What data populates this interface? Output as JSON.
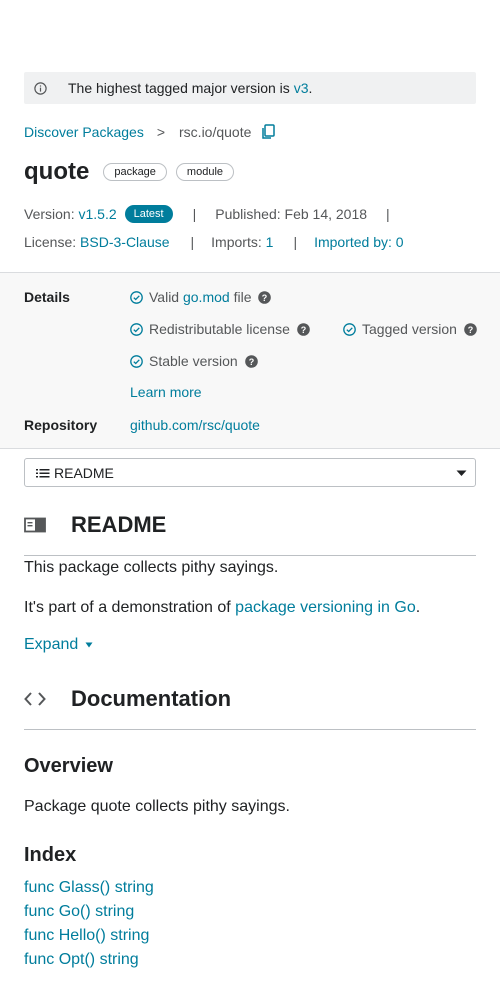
{
  "banner": {
    "text": "The highest tagged major version is",
    "version": "v3",
    "period": "."
  },
  "breadcrumb": {
    "root": "Discover Packages",
    "separator": ">",
    "current": "rsc.io/quote"
  },
  "title": {
    "name": "quote",
    "badges": [
      "package",
      "module"
    ]
  },
  "meta": {
    "version_label": "Version:",
    "version": "v1.5.2",
    "latest": "Latest",
    "published_label": "Published:",
    "published": "Feb 14, 2018",
    "license_label": "License:",
    "license": "BSD-3-Clause",
    "imports_label": "Imports:",
    "imports": "1",
    "imported_by": "Imported by: 0",
    "divider": "|"
  },
  "details": {
    "label": "Details",
    "valid_prefix": "Valid",
    "valid_link": "go.mod",
    "valid_suffix": "file",
    "redistributable": "Redistributable license",
    "tagged": "Tagged version",
    "stable": "Stable version",
    "learn_more": "Learn more",
    "repo_label": "Repository",
    "repo": "github.com/rsc/quote"
  },
  "jump": {
    "selected": "README"
  },
  "readme": {
    "heading": "README",
    "line1": "This package collects pithy sayings.",
    "line2_prefix": "It's part of a demonstration of",
    "line2_link": "package versioning in Go",
    "line2_suffix": ".",
    "expand": "Expand"
  },
  "docs": {
    "heading": "Documentation",
    "overview_heading": "Overview",
    "overview": "Package quote collects pithy sayings.",
    "index_heading": "Index",
    "index": [
      "func Glass() string",
      "func Go() string",
      "func Hello() string",
      "func Opt() string"
    ]
  },
  "colors": {
    "link": "#007d9c",
    "badge": "#007d9c",
    "panel": "#f8f8f8"
  }
}
